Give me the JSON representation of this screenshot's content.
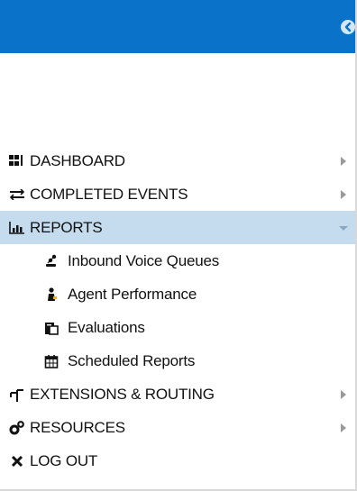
{
  "header": {
    "accent_color": "#0a72c9",
    "collapse_icon": "chevron-left-circle-icon"
  },
  "menu": {
    "items": [
      {
        "label": "DASHBOARD",
        "icon": "dashboard-grid-icon",
        "has_submenu": true
      },
      {
        "label": "COMPLETED EVENTS",
        "icon": "swap-arrows-icon",
        "has_submenu": true
      },
      {
        "label": "REPORTS",
        "icon": "bar-chart-icon",
        "has_submenu": true,
        "expanded": true,
        "active": true,
        "children": [
          {
            "label": "Inbound Voice Queues",
            "icon": "queue-icon"
          },
          {
            "label": "Agent Performance",
            "icon": "agent-icon"
          },
          {
            "label": "Evaluations",
            "icon": "evaluation-icon"
          },
          {
            "label": "Scheduled Reports",
            "icon": "calendar-icon"
          }
        ]
      },
      {
        "label": "EXTENSIONS & ROUTING",
        "icon": "routing-fork-icon",
        "has_submenu": true
      },
      {
        "label": "RESOURCES",
        "icon": "gears-icon",
        "has_submenu": true
      },
      {
        "label": "LOG OUT",
        "icon": "close-x-icon",
        "has_submenu": false
      }
    ]
  }
}
